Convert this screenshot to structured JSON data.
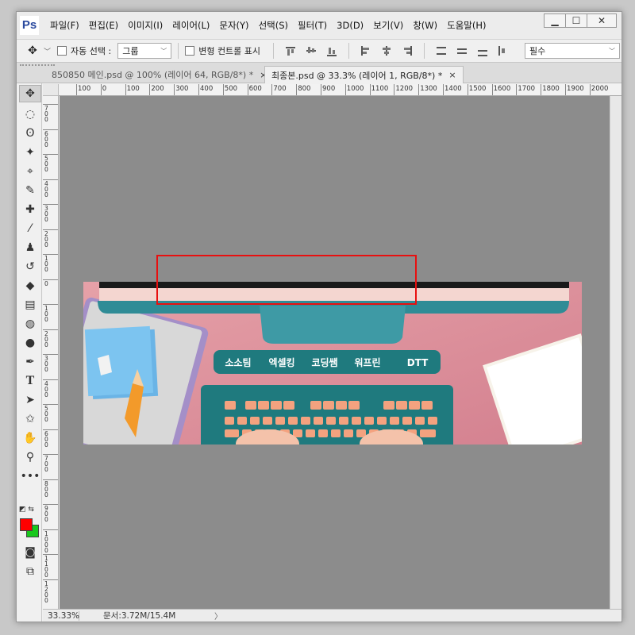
{
  "app": {
    "logo": "Ps",
    "menu": [
      "파일(F)",
      "편집(E)",
      "이미지(I)",
      "레이어(L)",
      "문자(Y)",
      "선택(S)",
      "필터(T)",
      "3D(D)",
      "보기(V)",
      "창(W)",
      "도움말(H)"
    ],
    "window_controls": {
      "minimize": "▁",
      "maximize": "☐",
      "close": "✕"
    }
  },
  "options": {
    "auto_select_label": "자동 선택 :",
    "auto_select_value": "그룹",
    "transform_label": "변형 컨트롤 표시",
    "workspace": "필수"
  },
  "tabs": [
    {
      "label": "850850 메인.psd @ 100% (레이어 64, RGB/8*) *",
      "active": false,
      "close": "×"
    },
    {
      "label": "최종본.psd @ 33.3% (레이어 1, RGB/8*) *",
      "active": true,
      "close": "×"
    }
  ],
  "ruler_labels": [
    "100",
    "0",
    "100",
    "200",
    "300",
    "400",
    "500",
    "600",
    "700",
    "800",
    "900",
    "1000",
    "1100",
    "1200",
    "1300",
    "1400",
    "1500",
    "1600",
    "1700",
    "1800",
    "1900",
    "2000"
  ],
  "vruler_labels": [
    "700",
    "600",
    "500",
    "400",
    "300",
    "200",
    "100",
    "0",
    "100",
    "200",
    "300",
    "400",
    "500",
    "600",
    "700",
    "800",
    "900",
    "1000",
    "1100",
    "1200"
  ],
  "banner": {
    "nav_items": [
      "소소팀",
      "엑셀킹",
      "코딩쌤",
      "워프린",
      "DTT"
    ]
  },
  "status": {
    "zoom": "33.33%",
    "doc_info": "문서:3.72M/15.4M",
    "arrow": "〉"
  },
  "colors": {
    "foreground": "#ff0000",
    "background": "#18c81c",
    "highlight_box": "#e81010",
    "banner_bg": "#d98b98",
    "nav_bar": "#1f7a7e"
  }
}
